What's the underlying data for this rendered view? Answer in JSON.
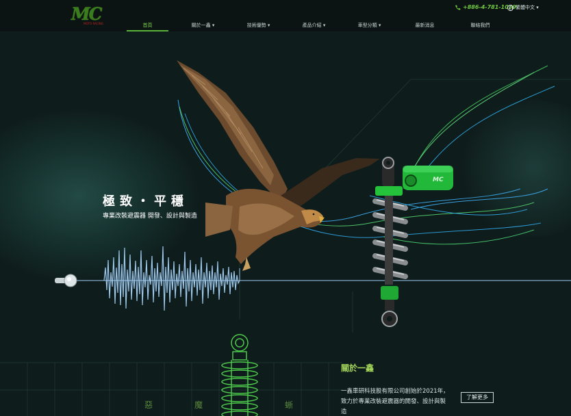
{
  "header": {
    "logo_text": "MC",
    "logo_sub": "MOTO RACING",
    "phone": "+886-4-781-1039",
    "language": "繁體中文 ▾"
  },
  "nav": [
    {
      "label": "首頁",
      "active": true
    },
    {
      "label": "關於一鑫 ▾"
    },
    {
      "label": "技術優勢 ▾"
    },
    {
      "label": "產品介紹 ▾"
    },
    {
      "label": "車型分類 ▾"
    },
    {
      "label": "最新消息"
    },
    {
      "label": "聯絡我們"
    }
  ],
  "hero": {
    "title": "極致・平穩",
    "subtitle": "專業改裝避震器 開發、設計與製造",
    "shock_badge": "MC"
  },
  "about": {
    "title": "關於一鑫",
    "text": "一鑫車研科技股有限公司創始於2021年，致力於專業改裝避震器的開發、設計與製造",
    "more_label": "了解更多"
  },
  "categories": [
    "惡",
    "魔",
    "蜥"
  ],
  "colors": {
    "accent_green": "#7ad04a",
    "shock_green": "#27c43a",
    "wave_blue": "#9cc8ee",
    "bg_dark": "#0e1c1b"
  },
  "icons": {
    "phone": "phone-icon",
    "language": "globe-icon"
  }
}
